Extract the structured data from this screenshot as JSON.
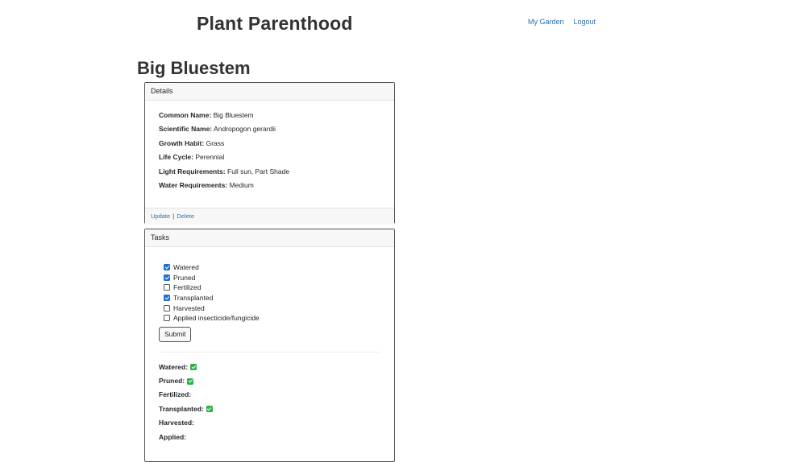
{
  "brand": "Plant Parenthood",
  "nav": {
    "my_garden": "My Garden",
    "logout": "Logout"
  },
  "plant_name": "Big Bluestem",
  "details": {
    "header": "Details",
    "rows": [
      {
        "label": "Common Name:",
        "value": "Big Bluestem"
      },
      {
        "label": "Scientific Name:",
        "value": "Andropogon gerardii"
      },
      {
        "label": "Growth Habit:",
        "value": "Grass"
      },
      {
        "label": "Life Cycle:",
        "value": "Perennial"
      },
      {
        "label": "Light Requirements:",
        "value": "Full sun, Part Shade"
      },
      {
        "label": "Water Requirements:",
        "value": "Medium"
      }
    ],
    "update_label": "Update",
    "separator": "|",
    "delete_label": "Delete"
  },
  "tasks": {
    "header": "Tasks",
    "checkboxes": [
      {
        "label": "Watered",
        "checked": true
      },
      {
        "label": "Pruned",
        "checked": true
      },
      {
        "label": "Fertilized",
        "checked": false
      },
      {
        "label": "Transplanted",
        "checked": true
      },
      {
        "label": "Harvested",
        "checked": false
      },
      {
        "label": "Applied insecticide/fungicide",
        "checked": false
      }
    ],
    "submit_label": "Submit",
    "status": [
      {
        "label": "Watered:",
        "done": true
      },
      {
        "label": "Pruned:",
        "done": true
      },
      {
        "label": "Fertilized:",
        "done": false
      },
      {
        "label": "Transplanted:",
        "done": true
      },
      {
        "label": "Harvested:",
        "done": false
      },
      {
        "label": "Applied:",
        "done": false
      }
    ]
  },
  "colors": {
    "link": "#2c6fad",
    "checkbox_checked": "#1d70d6",
    "done_check": "#2db14a"
  }
}
